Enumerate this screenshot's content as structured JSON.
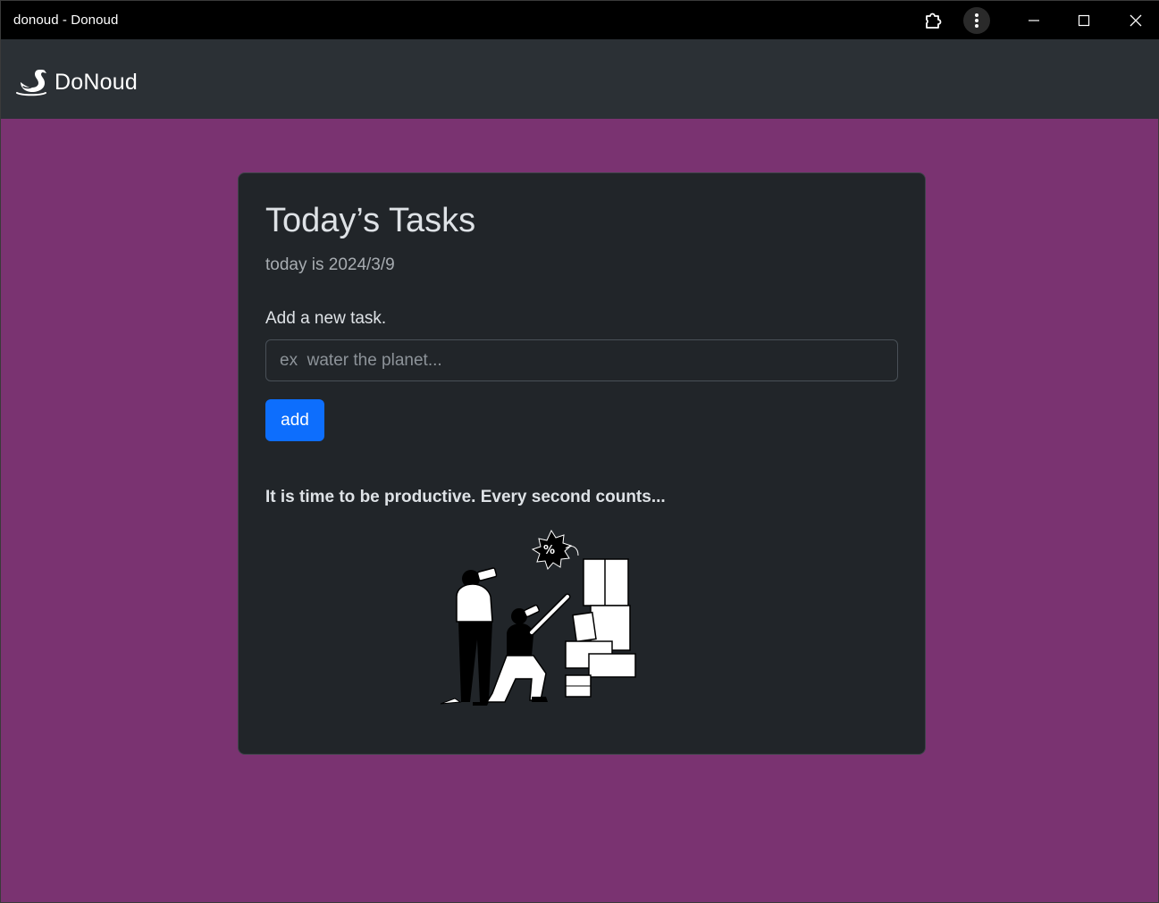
{
  "window": {
    "title": "donoud - Donoud",
    "controls": [
      "extensions-icon",
      "menu-icon",
      "minimize-icon",
      "maximize-icon",
      "close-icon"
    ]
  },
  "navbar": {
    "brand_name": "DoNoud",
    "brand_icon": "swan-icon"
  },
  "card": {
    "title": "Today’s Tasks",
    "subtitle": "today is 2024/3/9",
    "input_label": "Add a new task.",
    "input_placeholder": "ex  water the planet...",
    "input_value": "",
    "add_button_label": "add",
    "motivation": "It is time to be productive. Every second counts...",
    "illustration": "people-looking-at-boxes-illustration"
  },
  "colors": {
    "page_background": "#7a3371",
    "navbar_background": "#2b3035",
    "card_background": "#212529",
    "primary_button": "#0d6efd"
  }
}
